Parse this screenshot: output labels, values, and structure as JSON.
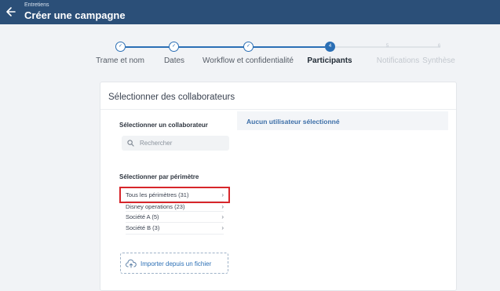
{
  "header": {
    "breadcrumb": "Entretiens",
    "title": "Créer une campagne",
    "back_icon": "arrow-left-icon",
    "background_color": "#2b4f78"
  },
  "stepper": {
    "steps": [
      {
        "label": "Trame et nom",
        "state": "done",
        "marker": "✓"
      },
      {
        "label": "Dates",
        "state": "done",
        "marker": "✓"
      },
      {
        "label": "Workflow et confidentialité",
        "state": "done",
        "marker": "✓"
      },
      {
        "label": "Participants",
        "state": "current",
        "marker": "4"
      },
      {
        "label": "Notifications",
        "state": "future",
        "marker": "5"
      },
      {
        "label": "Synthèse",
        "state": "future",
        "marker": "6"
      }
    ],
    "accent_color": "#2b6fb5"
  },
  "card": {
    "title": "Sélectionner des collaborateurs",
    "select_one": {
      "title": "Sélectionner un collaborateur",
      "search_placeholder": "Rechercher",
      "search_icon": "search-icon"
    },
    "select_perimeter": {
      "title": "Sélectionner par périmètre",
      "items": [
        {
          "label": "Tous les périmètres (31)",
          "highlighted": true
        },
        {
          "label": "Disney operations (23)",
          "highlighted": false
        },
        {
          "label": "Société A (5)",
          "highlighted": false
        },
        {
          "label": "Société B (3)",
          "highlighted": false
        }
      ],
      "highlight_color": "#d7262b"
    },
    "import": {
      "label": "Importer depuis un fichier",
      "icon": "cloud-upload-icon"
    },
    "selection_panel": {
      "empty_label": "Aucun utilisateur sélectionné"
    }
  }
}
